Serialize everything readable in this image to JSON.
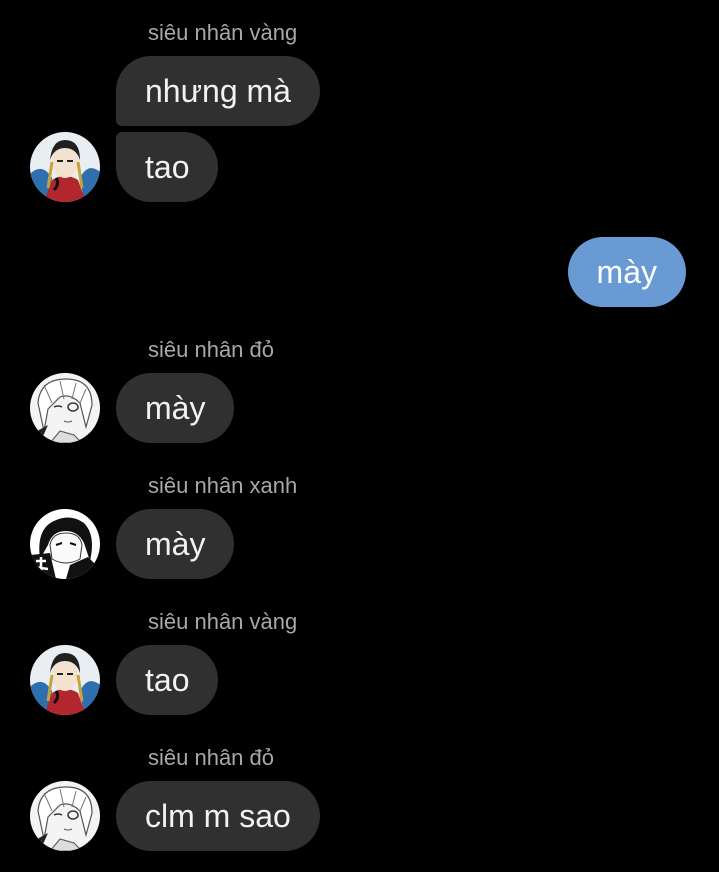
{
  "chat": {
    "messages": [
      {
        "sender": "siêu nhân vàng",
        "text": "nhưng mà",
        "avatar": "siêu nhân vàng avatar"
      },
      {
        "text": "tao"
      },
      {
        "text": "mày",
        "outgoing": true
      },
      {
        "sender": "siêu nhân đỏ",
        "text": "mày",
        "avatar": "siêu nhân đỏ avatar"
      },
      {
        "sender": "siêu nhân xanh",
        "text": "mày",
        "avatar": "siêu nhân xanh avatar"
      },
      {
        "sender": "siêu nhân vàng",
        "text": "tao",
        "avatar": "siêu nhân vàng avatar"
      },
      {
        "sender": "siêu nhân đỏ",
        "text": "clm m sao",
        "avatar": "siêu nhân đỏ avatar"
      }
    ]
  },
  "colors": {
    "background": "#000000",
    "incoming_bubble": "#303030",
    "outgoing_bubble": "#6a9ad4",
    "sender_name": "#a8a8a8"
  }
}
